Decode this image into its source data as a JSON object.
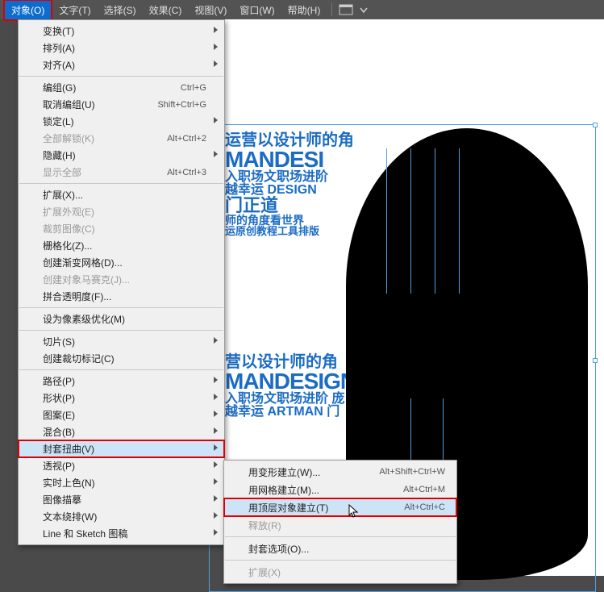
{
  "menubar": {
    "items": [
      {
        "label": "对象(O)",
        "active": true
      },
      {
        "label": "文字(T)"
      },
      {
        "label": "选择(S)"
      },
      {
        "label": "效果(C)"
      },
      {
        "label": "视图(V)"
      },
      {
        "label": "窗口(W)"
      },
      {
        "label": "帮助(H)"
      }
    ]
  },
  "menu": [
    {
      "label": "变换(T)",
      "arrow": true
    },
    {
      "label": "排列(A)",
      "arrow": true
    },
    {
      "label": "对齐(A)",
      "arrow": true
    },
    {
      "sep": true
    },
    {
      "label": "编组(G)",
      "accel": "Ctrl+G"
    },
    {
      "label": "取消编组(U)",
      "accel": "Shift+Ctrl+G"
    },
    {
      "label": "锁定(L)",
      "arrow": true
    },
    {
      "label": "全部解锁(K)",
      "accel": "Alt+Ctrl+2",
      "disabled": true
    },
    {
      "label": "隐藏(H)",
      "arrow": true
    },
    {
      "label": "显示全部",
      "accel": "Alt+Ctrl+3",
      "disabled": true
    },
    {
      "sep": true
    },
    {
      "label": "扩展(X)..."
    },
    {
      "label": "扩展外观(E)",
      "disabled": true
    },
    {
      "label": "裁剪图像(C)",
      "disabled": true
    },
    {
      "label": "栅格化(Z)..."
    },
    {
      "label": "创建渐变网格(D)..."
    },
    {
      "label": "创建对象马赛克(J)...",
      "disabled": true
    },
    {
      "label": "拼合透明度(F)..."
    },
    {
      "sep": true
    },
    {
      "label": "设为像素级优化(M)"
    },
    {
      "sep": true
    },
    {
      "label": "切片(S)",
      "arrow": true
    },
    {
      "label": "创建裁切标记(C)"
    },
    {
      "sep": true
    },
    {
      "label": "路径(P)",
      "arrow": true
    },
    {
      "label": "形状(P)",
      "arrow": true
    },
    {
      "label": "图案(E)",
      "arrow": true
    },
    {
      "label": "混合(B)",
      "arrow": true
    },
    {
      "label": "封套扭曲(V)",
      "arrow": true,
      "highlight": true
    },
    {
      "label": "透视(P)",
      "arrow": true
    },
    {
      "label": "实时上色(N)",
      "arrow": true
    },
    {
      "label": "图像描摹",
      "arrow": true
    },
    {
      "label": "文本绕排(W)",
      "arrow": true
    },
    {
      "label": "Line 和 Sketch 图稿",
      "arrow": true
    }
  ],
  "submenu": [
    {
      "label": "用变形建立(W)...",
      "accel": "Alt+Shift+Ctrl+W"
    },
    {
      "label": "用网格建立(M)...",
      "accel": "Alt+Ctrl+M"
    },
    {
      "label": "用顶层对象建立(T)",
      "accel": "Alt+Ctrl+C",
      "highlight": true
    },
    {
      "label": "释放(R)",
      "disabled": true
    },
    {
      "sep": true
    },
    {
      "label": "封套选项(O)..."
    },
    {
      "sep": true
    },
    {
      "label": "扩展(X)",
      "disabled": true
    }
  ],
  "canvas_text": {
    "line1": "运营以设计师的角",
    "line2": "MANDESI",
    "line3": "入职场文职场进阶",
    "line4": "越幸运 DESIGN",
    "line5": "门正道",
    "line6": "师的角度看世界",
    "line7": "运原创教程工具排版",
    "line8": "营以设计师的角",
    "line9": "MANDESIGN",
    "line10": "入职场文职场进阶 庞",
    "line11": "越幸运 ARTMAN 门"
  }
}
